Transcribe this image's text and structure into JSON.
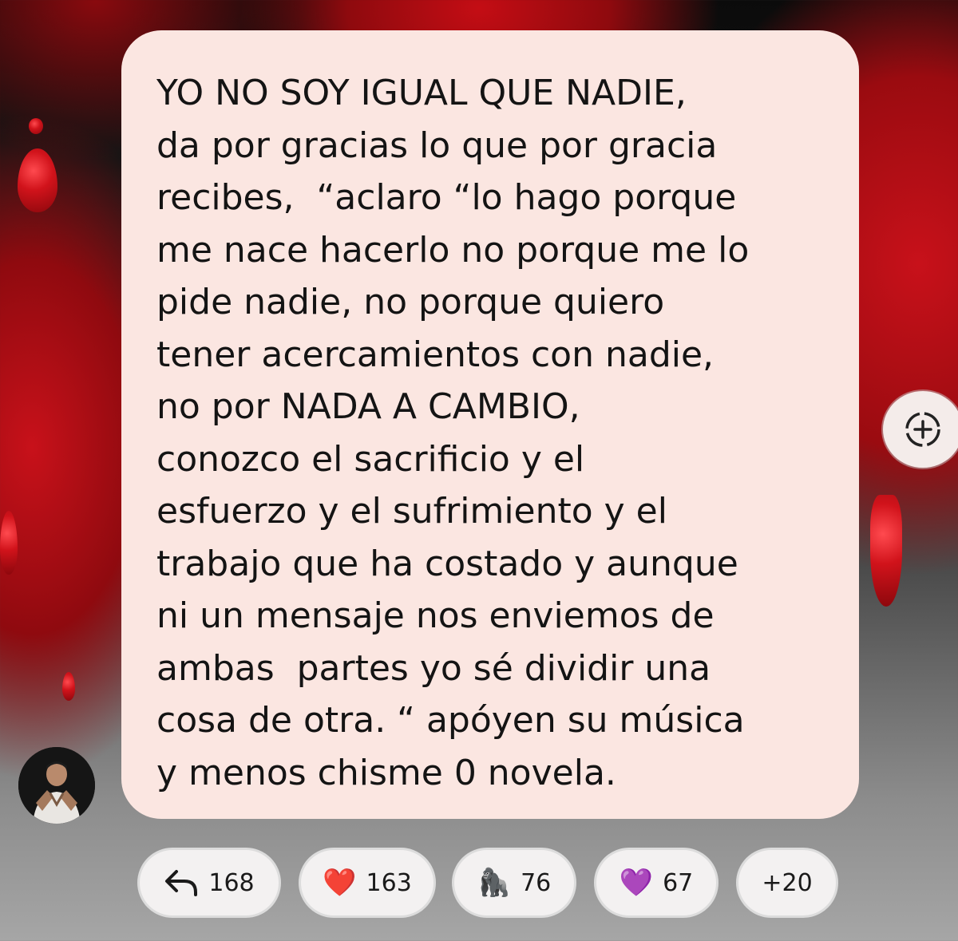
{
  "message": {
    "lines": [
      "YO NO SOY IGUAL QUE NADIE,",
      "da por gracias lo que por gracia",
      "recibes,  “aclaro “lo hago porque",
      "me nace hacerlo no porque me lo",
      "pide nadie, no porque quiero",
      "tener acercamientos con nadie,",
      "no por NADA A CAMBIO,",
      "conozco el sacrificio y el",
      "esfuerzo y el sufrimiento y el",
      "trabajo que ha costado y aunque",
      "ni un mensaje nos enviemos de",
      "ambas  partes yo sé dividir una",
      "cosa de otra. “ apóyen su música",
      "y menos chisme 0 novela."
    ]
  },
  "reactions": {
    "reply": {
      "icon": "reply-arrow-icon",
      "count": "168"
    },
    "heart": {
      "emoji": "❤️",
      "icon": "red-heart-icon",
      "count": "163"
    },
    "gorilla": {
      "emoji": "🦍",
      "icon": "gorilla-icon",
      "count": "76"
    },
    "purple_heart": {
      "emoji": "💜",
      "icon": "purple-heart-icon",
      "count": "67"
    },
    "more": {
      "label": "+20"
    }
  },
  "colors": {
    "bubble": "#fbe6e1",
    "chip_bg": "#f3f1f1",
    "accent_red": "#c8111a"
  }
}
